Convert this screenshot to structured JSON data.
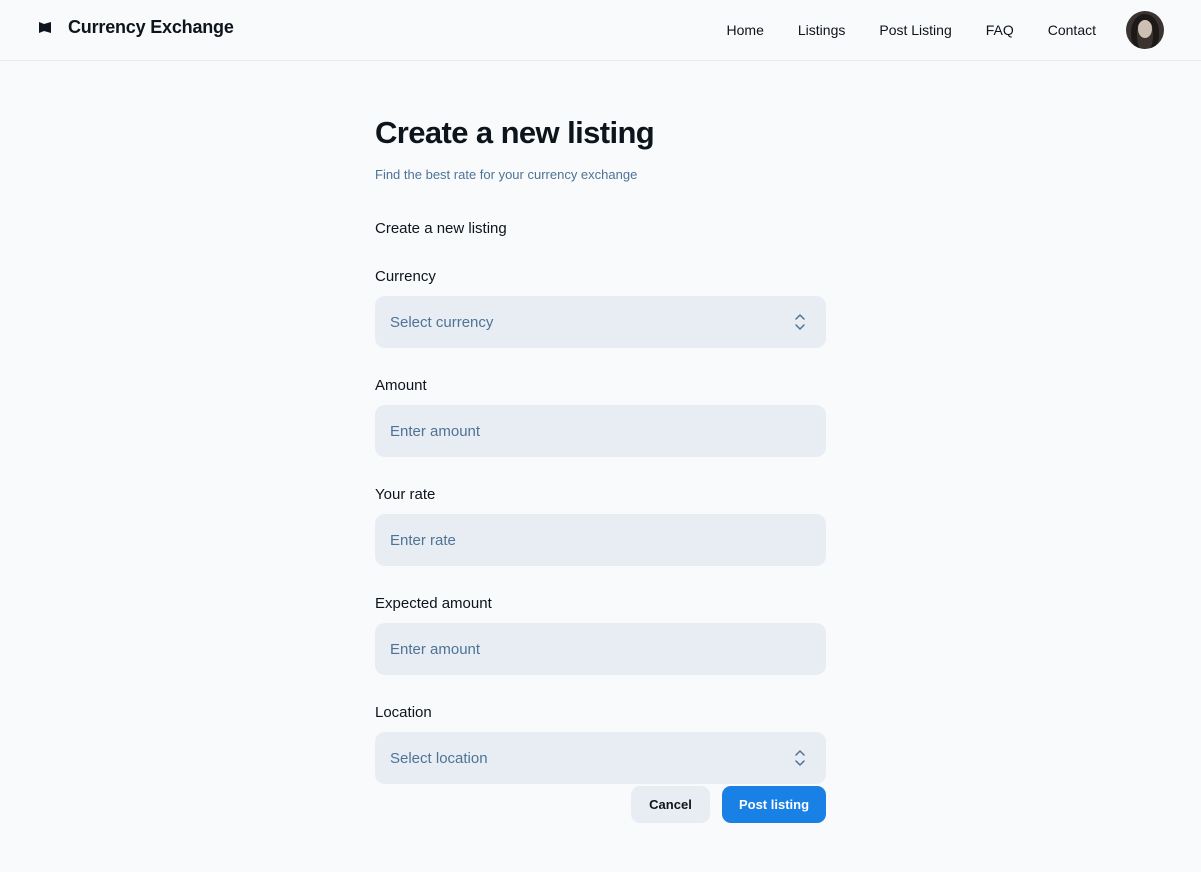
{
  "header": {
    "brand_icon": "flag-icon",
    "title": "Currency Exchange",
    "nav": [
      {
        "label": "Home"
      },
      {
        "label": "Listings"
      },
      {
        "label": "Post Listing"
      },
      {
        "label": "FAQ"
      },
      {
        "label": "Contact"
      }
    ],
    "avatar": "user-avatar"
  },
  "page": {
    "title": "Create a new listing",
    "subtitle": "Find the best rate for your currency exchange",
    "section_title": "Create a new listing"
  },
  "form": {
    "currency": {
      "label": "Currency",
      "placeholder": "Select currency",
      "icon": "chevron-up-down-icon"
    },
    "amount": {
      "label": "Amount",
      "placeholder": "Enter amount"
    },
    "rate": {
      "label": "Your rate",
      "placeholder": "Enter rate"
    },
    "expected": {
      "label": "Expected amount",
      "placeholder": "Enter amount"
    },
    "location": {
      "label": "Location",
      "placeholder": "Select location",
      "icon": "chevron-up-down-icon"
    }
  },
  "actions": {
    "cancel_label": "Cancel",
    "post_label": "Post listing"
  },
  "colors": {
    "background": "#f8fafc",
    "input_bg": "#e7edf3",
    "placeholder": "#4e7397",
    "primary": "#1980e6",
    "text": "#0e141b"
  }
}
